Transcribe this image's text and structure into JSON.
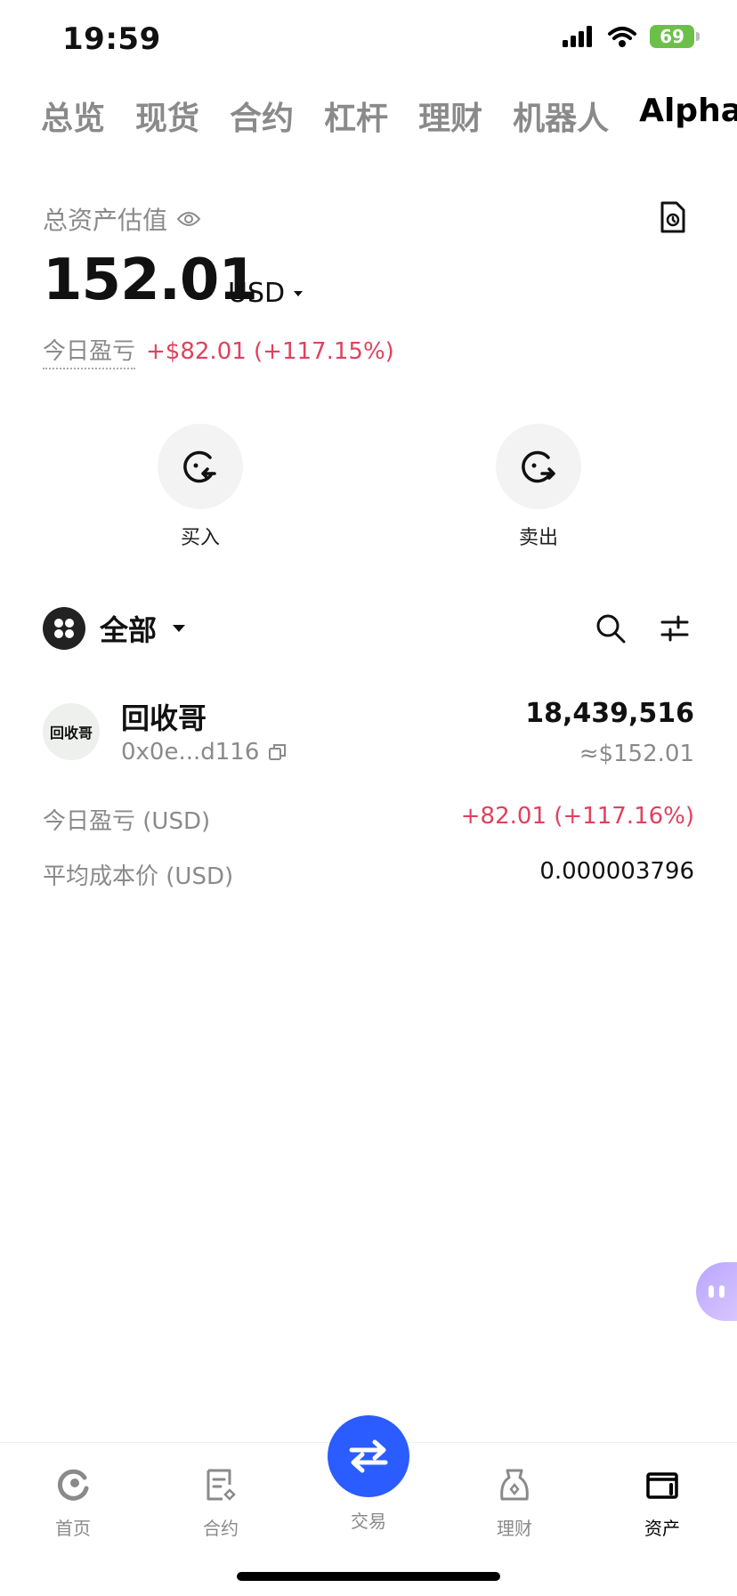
{
  "status_bar": {
    "time": "19:59",
    "battery": "69"
  },
  "top_tabs": [
    {
      "label": "总览"
    },
    {
      "label": "现货"
    },
    {
      "label": "合约"
    },
    {
      "label": "杠杆"
    },
    {
      "label": "理财"
    },
    {
      "label": "机器人"
    },
    {
      "label": "Alpha",
      "active": true
    }
  ],
  "summary": {
    "total_label": "总资产估值",
    "total_value": "152.01",
    "currency": "USD",
    "pnl_label": "今日盈亏",
    "pnl_value": "+$82.01 (+117.15%)"
  },
  "actions": {
    "buy": "买入",
    "sell": "卖出"
  },
  "filter": {
    "label": "全部"
  },
  "token": {
    "avatar_text": "回收哥",
    "name": "回收哥",
    "address": "0x0e...d116",
    "amount": "18,439,516",
    "usd_value": "≈$152.01",
    "pnl_label": "今日盈亏 (USD)",
    "pnl_value": "+82.01 (+117.16%)",
    "avg_cost_label": "平均成本价 (USD)",
    "avg_cost_value": "0.000003796"
  },
  "bottom_nav": {
    "home": "首页",
    "contracts": "合约",
    "trade": "交易",
    "finance": "理财",
    "assets": "资产"
  },
  "colors": {
    "accent": "#2b5cff",
    "gain": "#e0415e",
    "muted": "#8a8a8a",
    "battery": "#6cc04a"
  }
}
